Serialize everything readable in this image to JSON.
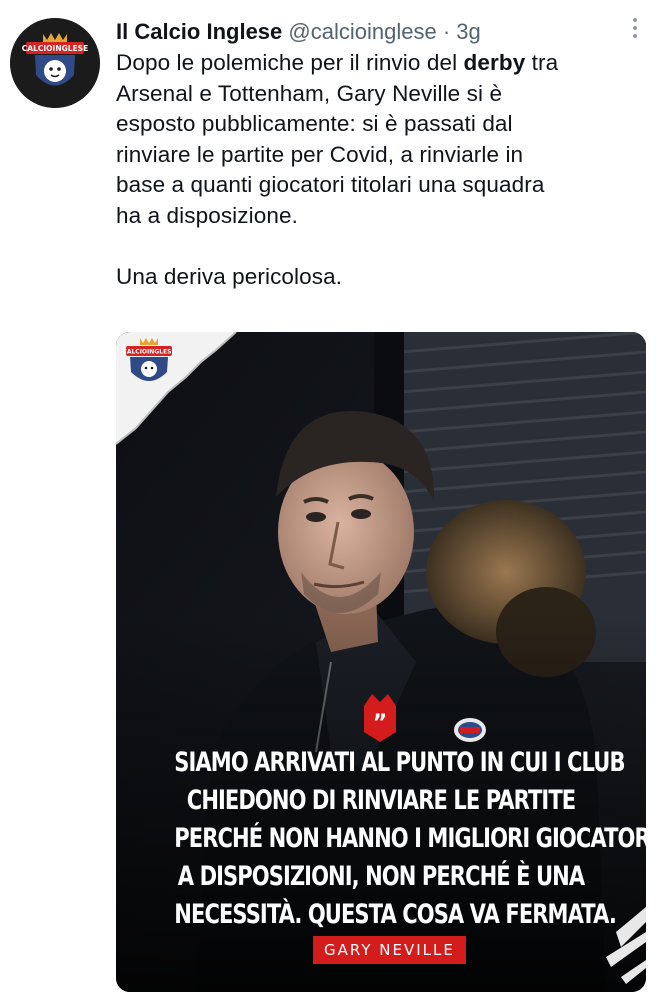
{
  "tweet": {
    "display_name": "Il Calcio Inglese",
    "handle": "@calcioinglese",
    "separator": "·",
    "time": "3g",
    "text_lines": [
      [
        "Dopo le polemiche per il rinvio del ",
        "derby",
        " tra"
      ],
      "Arsenal e Tottenham, Gary Neville si è",
      "esposto pubblicamente: si è passati dal",
      "rinviare le partite per Covid, a rinviarle in",
      "base a quanti giocatori titolari una squadra",
      "ha a disposizione."
    ],
    "text_last": "Una deriva pericolosa."
  },
  "avatar": {
    "logo_text": "CALCIOINGLESE"
  },
  "media": {
    "logo_text": "CALCIOINGLESE",
    "quote_mark": "”",
    "quote_lines": [
      "SIAMO ARRIVATI AL PUNTO IN CUI I CLUB",
      "CHIEDONO DI RINVIARE LE PARTITE",
      "PERCHÉ NON HANNO I MIGLIORI GIOCATORI",
      "A DISPOSIZIONI, NON PERCHÉ È UNA",
      "NECESSITÀ. QUESTA COSA VA FERMATA."
    ],
    "author": "GARY NEVILLE"
  },
  "colors": {
    "name": "#0f1419",
    "secondary": "#536471",
    "accent_red": "#d41c1c",
    "media_bg": "#121418"
  },
  "icons": {
    "more": "more-vertical-icon",
    "quote": "quote-icon",
    "badge": "moncler-badge-icon"
  }
}
